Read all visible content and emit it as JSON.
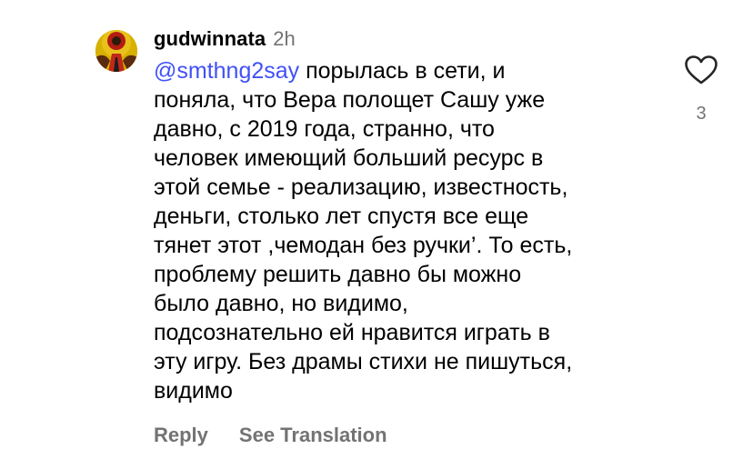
{
  "comment": {
    "username": "gudwinnata",
    "timestamp": "2h",
    "mention": "@smthng2say",
    "lines": [
      " порылась в сети, и",
      "поняла, что Вера полощет Сашу уже",
      "давно, с 2019 года, странно, что",
      "человек имеющий больший ресурс в",
      "этой семье - реализацию, известность,",
      "деньги, столько лет спустя все еще",
      "тянет этот ,чемодан без ручки’. То есть,",
      "проблему решить давно бы можно",
      "было давно, но видимо,",
      "подсознательно ей нравится играть в",
      "эту игру. Без драмы стихи не пишуться,",
      "видимо"
    ],
    "like_count": "3",
    "like_icon": "heart-outline-icon"
  },
  "actions": {
    "reply_label": "Reply",
    "translate_label": "See Translation"
  },
  "colors": {
    "mention": "#4150f7",
    "secondary_text": "#737373",
    "primary_text": "#000000"
  }
}
